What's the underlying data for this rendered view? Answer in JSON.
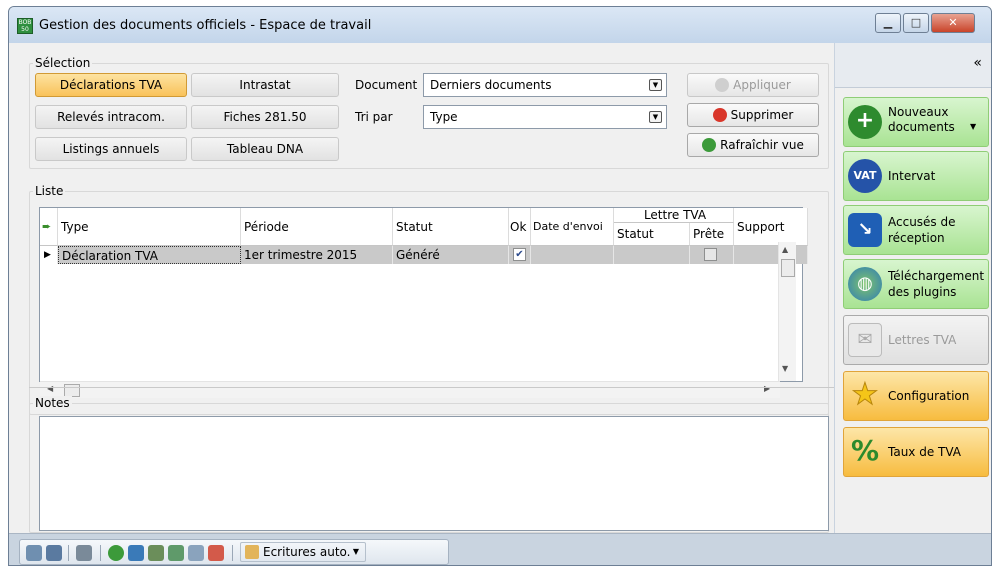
{
  "window": {
    "title": "Gestion des documents officiels - Espace de travail",
    "app_icon_text": "BOB 50",
    "controls": {
      "minimize": "▁",
      "maximize": "□",
      "close": "✕"
    }
  },
  "selection": {
    "group_label": "Sélection",
    "buttons": [
      {
        "label": "Déclarations TVA",
        "active": true
      },
      {
        "label": "Intrastat"
      },
      {
        "label": "Relevés intracom."
      },
      {
        "label": "Fiches 281.50"
      },
      {
        "label": "Listings annuels"
      },
      {
        "label": "Tableau DNA"
      }
    ],
    "document_label": "Document",
    "document_value": "Derniers documents",
    "sort_label": "Tri par",
    "sort_value": "Type",
    "apply_label": "Appliquer",
    "delete_label": "Supprimer",
    "refresh_label": "Rafraîchir vue"
  },
  "list": {
    "group_label": "Liste",
    "columns": {
      "type": "Type",
      "period": "Période",
      "status": "Statut",
      "ok": "Ok",
      "send_date": "Date d'envoi",
      "letter_group": "Lettre TVA",
      "letter_status": "Statut",
      "letter_ready": "Prête",
      "support": "Support"
    },
    "rows": [
      {
        "type": "Déclaration TVA",
        "period": "1er trimestre 2015",
        "status": "Généré",
        "ok": true,
        "send_date": "",
        "letter_status": "",
        "letter_ready": false,
        "support": ""
      }
    ]
  },
  "notes": {
    "group_label": "Notes",
    "value": ""
  },
  "sidebar": {
    "collapse_label": "«",
    "items": [
      {
        "label": "Nouveaux documents",
        "icon": "plus-icon",
        "color": "#2e8b2e"
      },
      {
        "label": "Intervat",
        "icon": "vat-icon",
        "badge": "VAT",
        "color": "#2553a8"
      },
      {
        "label": "Accusés de réception",
        "icon": "arrow-down-icon",
        "color": "#1f5fb5"
      },
      {
        "label": "Téléchargement des plugins",
        "icon": "globe-icon",
        "color": "#2e7bb8"
      },
      {
        "label": "Lettres TVA",
        "icon": "letters-icon",
        "disabled": true
      },
      {
        "label": "Configuration",
        "icon": "star-icon"
      },
      {
        "label": "Taux de TVA",
        "icon": "percent-icon"
      }
    ]
  },
  "toolbar": {
    "ecritures_label": "Ecritures auto."
  }
}
